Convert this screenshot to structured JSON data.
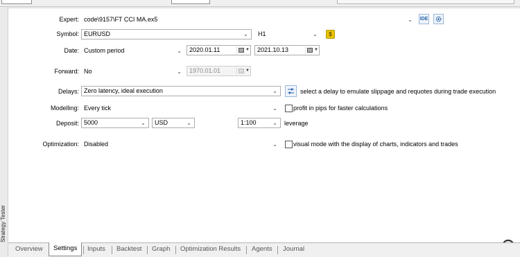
{
  "panel": {
    "vertical_title": "Strategy Tester"
  },
  "labels": {
    "expert": "Expert:",
    "symbol": "Symbol:",
    "date": "Date:",
    "forward": "Forward:",
    "delays": "Delays:",
    "modelling": "Modelling:",
    "deposit": "Deposit:",
    "optimization": "Optimization:"
  },
  "fields": {
    "expert": "code\\9157\\FT CCI MA.ex5",
    "ide_label": "IDE",
    "symbol": "EURUSD",
    "timeframe": "H1",
    "coin_label": "$",
    "date_mode": "Custom period",
    "date_from": "2020.01.11",
    "date_to": "2021.10.13",
    "forward": "No",
    "forward_date": "1970.01.01",
    "delays": "Zero latency, ideal execution",
    "delays_hint": "select a delay to emulate slippage and requotes during trade execution",
    "modelling": "Every tick",
    "profit_pips_label": "profit in pips for faster calculations",
    "deposit": "5000",
    "currency": "USD",
    "leverage": "1:100",
    "leverage_label": "leverage",
    "optimization": "Disabled",
    "visual_mode_label": "visual mode with the display of charts, indicators and trades"
  },
  "tabs": [
    "Overview",
    "Settings",
    "Inputs",
    "Backtest",
    "Graph",
    "Optimization Results",
    "Agents",
    "Journal"
  ],
  "active_tab": "Settings",
  "colors": {
    "accent": "#2b62a6",
    "coin": "#e8c300"
  }
}
